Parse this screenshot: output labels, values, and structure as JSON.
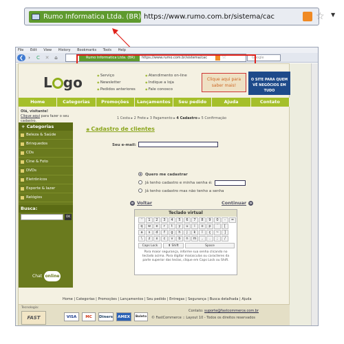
{
  "zoom_bar": {
    "identity": "Rumo Informatica Ltda. (BR)",
    "url": "https://www.rumo.com.br/sistema/cac",
    "rss_icon": "rss-icon",
    "star_icon": "bookmark-star-icon",
    "dropdown_icon": "chevron-down-icon"
  },
  "browser": {
    "menu": [
      "File",
      "Edit",
      "View",
      "History",
      "Bookmarks",
      "Tools",
      "Help"
    ],
    "identity": "Rumo Informatica Ltda. (BR)",
    "url": "https://www.rumo.com.br/sistema/cac",
    "search_placeholder": "Google",
    "buttons": {
      "back": "❮",
      "forward": "›",
      "reload": "C",
      "stop": "✕",
      "home": "⌂"
    }
  },
  "header": {
    "logo": "Lgo",
    "links_col1": [
      "Serviço",
      "Newsletter",
      "Pedidos anteriores"
    ],
    "links_col2": [
      "Atendimento on-line",
      "Indique a loja",
      "Fale conosco"
    ],
    "chat_text": "Clique aqui para saber mais!",
    "promo_text": "O SITE PARA QUEM VÊ NEGÓCIOS EM TUDO"
  },
  "nav": [
    "Home",
    "Categorias",
    "Promoções",
    "Lançamentos",
    "Seu pedido",
    "Ajuda",
    "Contato"
  ],
  "sidebar": {
    "welcome_line1": "Olá, visitante!",
    "welcome_link": "Clique aqui",
    "welcome_line2": " para fazer o seu cadastro.",
    "categories_title": "+ Categorias",
    "categories": [
      "Beleza & Saúde",
      "Brinquedos",
      "CDs",
      "Cine & Foto",
      "DVDs",
      "Eletrônicos",
      "Esporte & lazer",
      "Relógios"
    ],
    "search_title": "Busca:",
    "search_ok": "OK",
    "chat_label": "Chat",
    "chat_status": "online"
  },
  "main": {
    "steps": [
      "1 Cesta",
      "2 Frete",
      "3 Pagamento",
      "4 Cadastro",
      "5 Confirmação"
    ],
    "current_step": "4 Cadastro",
    "form_title": "Cadastro de clientes",
    "email_label": "Seu e-mail:",
    "radio_options": [
      "Quero me cadastrar",
      "Já tenho cadastro e minha senha é:",
      "Já tenho cadastro mas não tenho a senha"
    ],
    "selected_option": "Quero me cadastrar",
    "back_label": "Voltar",
    "continue_label": "Continuar",
    "keyboard": {
      "title": "Teclado virtual",
      "rows": [
        [
          "'",
          "1",
          "2",
          "3",
          "4",
          "5",
          "6",
          "7",
          "8",
          "9",
          "0",
          "-",
          "="
        ],
        [
          "q",
          "w",
          "e",
          "r",
          "t",
          "y",
          "u",
          "i",
          "o",
          "p",
          "´",
          "["
        ],
        [
          "a",
          "s",
          "d",
          "f",
          "g",
          "h",
          "j",
          "k",
          "l",
          "ç",
          "~",
          "]"
        ],
        [
          "\\",
          "z",
          "x",
          "c",
          "v",
          "b",
          "n",
          "m",
          ",",
          ".",
          ";",
          "/"
        ]
      ],
      "caps": "Caps Lock",
      "shift": "⬆ Shift",
      "space": "Space",
      "note": "Para maior segurança, informe sua senha clicando no teclado acima. Para digitar maiúsculas ou caracteres da parte superior das teclas, clique em Caps Lock ou Shift."
    }
  },
  "footer": {
    "links": [
      "Home",
      "Categorias",
      "Promoções",
      "Lançamentos",
      "Seu pedido",
      "Entregas",
      "Segurança",
      "Busca detalhada",
      "Ajuda"
    ],
    "tech_label": "Tecnologia:",
    "tech_logo": "FAST",
    "payments": [
      "VISA",
      "MC",
      "Diners",
      "AMEX",
      "Boleto"
    ],
    "contact_label": "Contato: ",
    "contact_email": "suporte@fastcommerce.com.br",
    "copyright": "© FastCommerce :: Layout 10 - Todos os direitos reservados"
  },
  "colors": {
    "accent_green": "#8aa51b",
    "highlight_red": "#e0211a",
    "identity_green": "#5f9a2e"
  }
}
